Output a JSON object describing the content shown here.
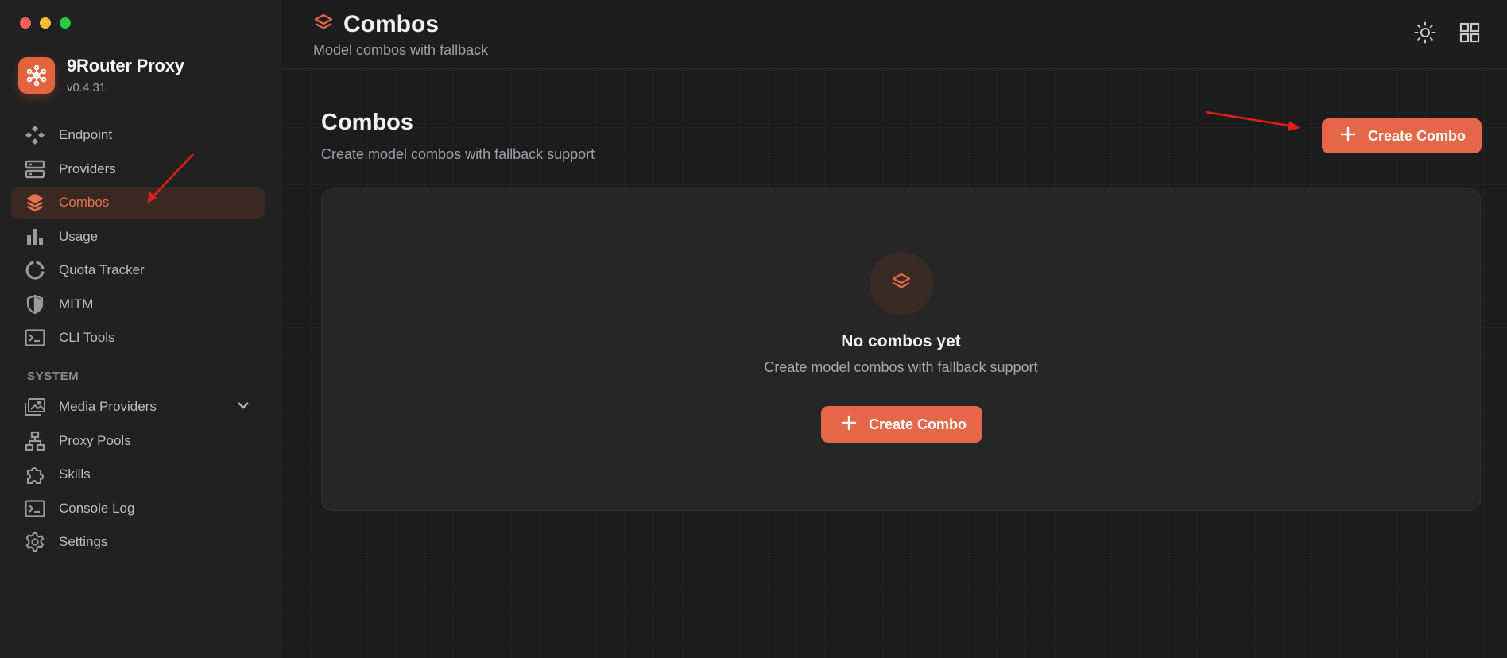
{
  "app": {
    "name": "9Router Proxy",
    "version": "v0.4.31"
  },
  "sidebar": {
    "items": [
      {
        "label": "Endpoint",
        "icon": "endpoint-icon"
      },
      {
        "label": "Providers",
        "icon": "server-icon"
      },
      {
        "label": "Combos",
        "icon": "layers-icon",
        "active": true
      },
      {
        "label": "Usage",
        "icon": "bar-chart-icon"
      },
      {
        "label": "Quota Tracker",
        "icon": "donut-icon"
      },
      {
        "label": "MITM",
        "icon": "shield-icon"
      },
      {
        "label": "CLI Tools",
        "icon": "terminal-icon"
      }
    ],
    "system_label": "SYSTEM",
    "system_items": [
      {
        "label": "Media Providers",
        "icon": "media-icon",
        "expandable": true
      },
      {
        "label": "Proxy Pools",
        "icon": "sitemap-icon"
      },
      {
        "label": "Skills",
        "icon": "puzzle-icon"
      },
      {
        "label": "Console Log",
        "icon": "terminal-icon"
      },
      {
        "label": "Settings",
        "icon": "gear-icon"
      }
    ]
  },
  "header": {
    "title": "Combos",
    "subtitle": "Model combos with fallback"
  },
  "main": {
    "title": "Combos",
    "subtitle": "Create model combos with fallback support",
    "create_button_label": "Create Combo",
    "empty_state": {
      "title": "No combos yet",
      "subtitle": "Create model combos with fallback support",
      "button_label": "Create Combo"
    }
  },
  "colors": {
    "accent": "#e5674a",
    "background": "#1c1c1c",
    "sidebar": "#212121",
    "card": "#262626"
  }
}
